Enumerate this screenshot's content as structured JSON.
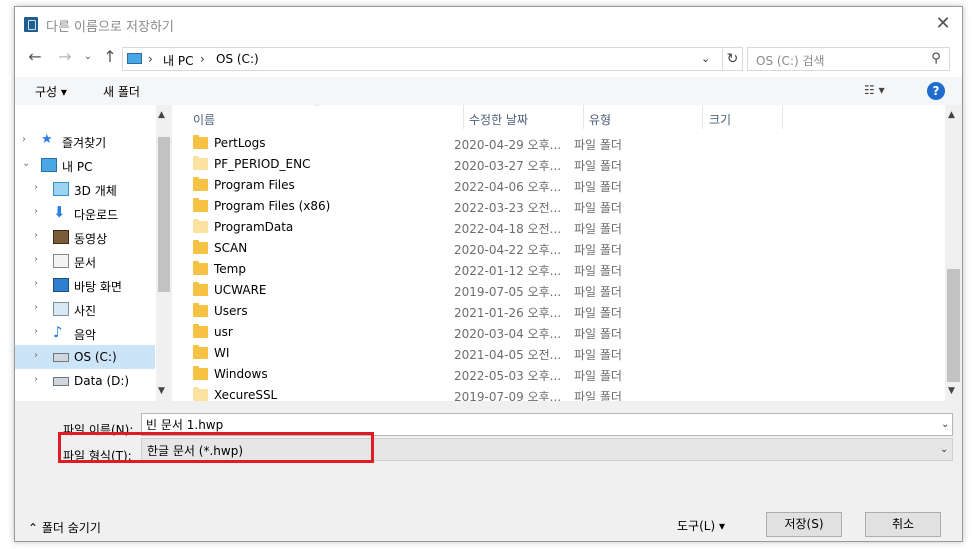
{
  "window": {
    "title": "다른 이름으로 저장하기",
    "close_icon": "✕"
  },
  "address": {
    "crumbs": [
      "내 PC",
      "OS (C:)"
    ],
    "separator": "›",
    "search_placeholder": "OS (C:) 검색"
  },
  "toolbar": {
    "organize": "구성 ▾",
    "new_folder": "새 폴더"
  },
  "nav": {
    "items": [
      {
        "label": "즐겨찾기",
        "icon": "star-icon",
        "indent": 1,
        "chevron": "›"
      },
      {
        "label": "내 PC",
        "icon": "computer-icon",
        "indent": 1,
        "chevron": "⌄"
      },
      {
        "label": "3D 개체",
        "icon": "cube-icon",
        "indent": 2,
        "chevron": "›"
      },
      {
        "label": "다운로드",
        "icon": "download-icon",
        "indent": 2,
        "chevron": "›"
      },
      {
        "label": "동영상",
        "icon": "video-icon",
        "indent": 2,
        "chevron": "›"
      },
      {
        "label": "문서",
        "icon": "document-icon",
        "indent": 2,
        "chevron": "›"
      },
      {
        "label": "바탕 화면",
        "icon": "desktop-icon",
        "indent": 2,
        "chevron": "›"
      },
      {
        "label": "사진",
        "icon": "picture-icon",
        "indent": 2,
        "chevron": "›"
      },
      {
        "label": "음악",
        "icon": "music-icon",
        "indent": 2,
        "chevron": "›"
      },
      {
        "label": "OS (C:)",
        "icon": "drive-icon",
        "indent": 2,
        "chevron": "›",
        "selected": true
      },
      {
        "label": "Data (D:)",
        "icon": "drive-icon",
        "indent": 2,
        "chevron": "›"
      }
    ]
  },
  "columns": {
    "name": "이름",
    "modified": "수정한 날짜",
    "type": "유형",
    "size": "크기"
  },
  "files": [
    {
      "name": "PertLogs",
      "modified": "2020-04-29 오후...",
      "type": "파일 폴더"
    },
    {
      "name": "PF_PERIOD_ENC",
      "modified": "2020-03-27 오후...",
      "type": "파일 폴더",
      "pale": true
    },
    {
      "name": "Program Files",
      "modified": "2022-04-06 오후...",
      "type": "파일 폴더"
    },
    {
      "name": "Program Files (x86)",
      "modified": "2022-03-23 오전...",
      "type": "파일 폴더"
    },
    {
      "name": "ProgramData",
      "modified": "2022-04-18 오전...",
      "type": "파일 폴더",
      "pale": true
    },
    {
      "name": "SCAN",
      "modified": "2020-04-22 오후...",
      "type": "파일 폴더"
    },
    {
      "name": "Temp",
      "modified": "2022-01-12 오후...",
      "type": "파일 폴더"
    },
    {
      "name": "UCWARE",
      "modified": "2019-07-05 오후...",
      "type": "파일 폴더"
    },
    {
      "name": "Users",
      "modified": "2021-01-26 오후...",
      "type": "파일 폴더"
    },
    {
      "name": "usr",
      "modified": "2020-03-04 오후...",
      "type": "파일 폴더"
    },
    {
      "name": "WI",
      "modified": "2021-04-05 오전...",
      "type": "파일 폴더"
    },
    {
      "name": "Windows",
      "modified": "2022-05-03 오후...",
      "type": "파일 폴더"
    },
    {
      "name": "XecureSSL",
      "modified": "2019-07-09 오후...",
      "type": "파일 폴더",
      "pale": true
    }
  ],
  "form": {
    "filename_label": "파일 이름(N):",
    "filename_value": "빈 문서 1.hwp",
    "filetype_label": "파일 형식(T):",
    "filetype_value": "한글 문서 (*.hwp)",
    "hide_folders": "⌃ 폴더 숨기기",
    "tools": "도구(L)   ▾",
    "save": "저장(S)",
    "cancel": "취소"
  },
  "colors": {
    "highlight": "#e11b22",
    "selection": "#cce4f7",
    "help": "#1f6bd0",
    "folder": "#f5c244"
  }
}
